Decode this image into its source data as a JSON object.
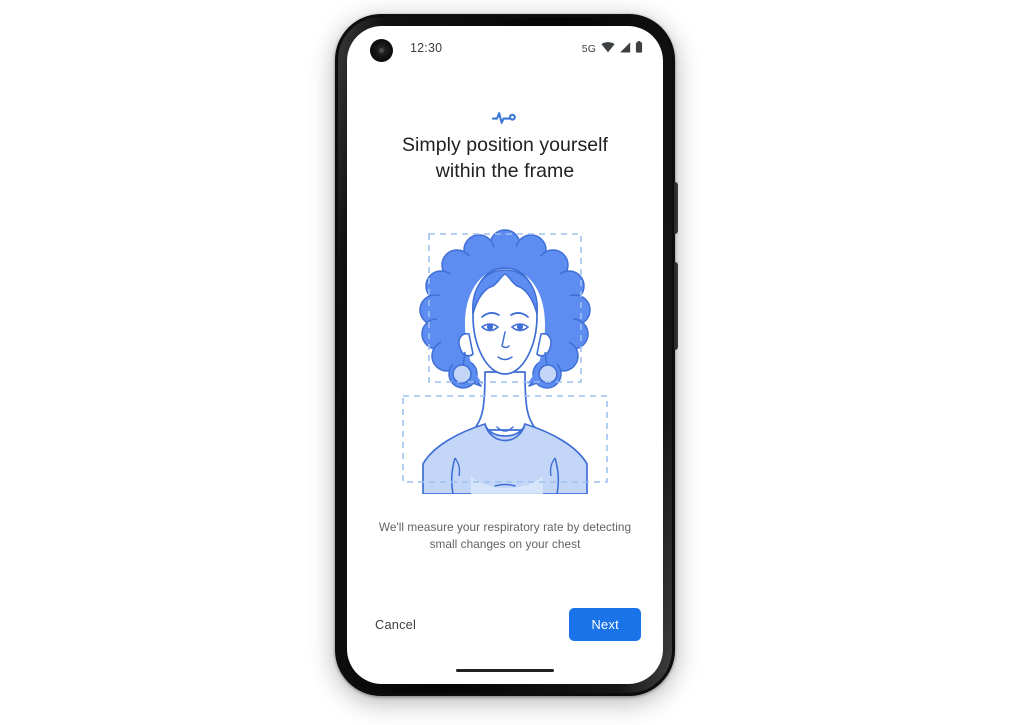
{
  "device": {
    "name": "smartphone-mockup",
    "status_bar": {
      "time": "12:30",
      "network": "5G",
      "icons": [
        "wifi-icon",
        "cellular-signal-icon",
        "battery-icon"
      ]
    },
    "home_indicator": "home-indicator"
  },
  "screen": {
    "brand_icon": "heart-rate-pulse-icon",
    "headline": "Simply position yourself within the frame",
    "headline_line1": "Simply position yourself",
    "headline_line2": "within the frame",
    "body_text": "We'll measure your respiratory rate by detecting small changes on your chest",
    "body_line1": "We'll measure your respiratory rate by detecting",
    "body_line2": "small changes on your chest",
    "illustration": {
      "name": "person-in-frame-illustration",
      "description": "Illustrated person with afro hair and round earrings inside dashed head frame, and chest in a dashed chest frame",
      "head_frame_label": "head-alignment-frame",
      "chest_frame_label": "chest-alignment-frame"
    },
    "actions": {
      "cancel_label": "Cancel",
      "next_label": "Next"
    }
  },
  "colors": {
    "accent_blue": "#1a73e8",
    "hair_blue": "#5d8df0",
    "shirt_blue": "#c3d6f7",
    "outline_blue": "#3f6fd6",
    "dashed_frame_blue": "#9fc0f0",
    "text_primary": "#202124",
    "text_secondary": "#5f6368",
    "screen_background": "#ffffff",
    "device_body": "#0d0d0d"
  }
}
